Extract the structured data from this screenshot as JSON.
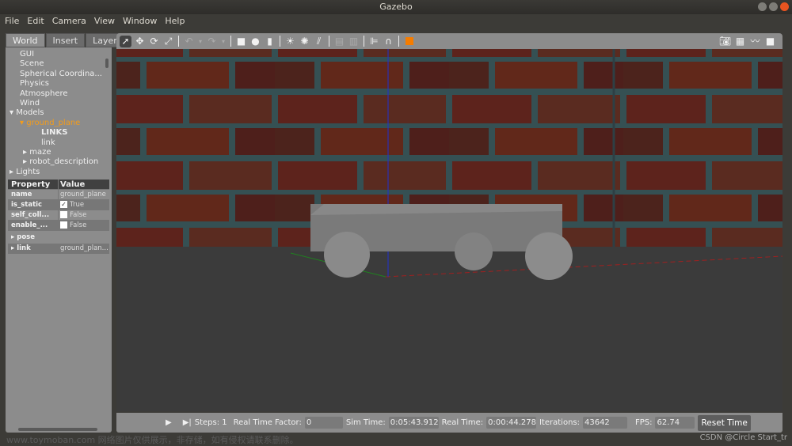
{
  "window": {
    "title": "Gazebo"
  },
  "menu": [
    "File",
    "Edit",
    "Camera",
    "View",
    "Window",
    "Help"
  ],
  "left_panel": {
    "tabs": [
      "World",
      "Insert",
      "Layers"
    ],
    "tree": [
      "GUI",
      "Scene",
      "Spherical Coordina...",
      "Physics",
      "Atmosphere",
      "Wind",
      "Models",
      "ground_plane",
      "LINKS",
      "link",
      "maze",
      "robot_description",
      "Lights"
    ],
    "properties": {
      "headers": [
        "Property",
        "Value"
      ],
      "rows": [
        {
          "key": "name",
          "value": "ground_plane"
        },
        {
          "key": "is_static",
          "value": "True",
          "checked": true
        },
        {
          "key": "self_coll...",
          "value": "False",
          "checked": false
        },
        {
          "key": "enable_...",
          "value": "False",
          "checked": false
        },
        {
          "key": "pose",
          "value": ""
        },
        {
          "key": "link",
          "value": "ground_plan..."
        }
      ]
    }
  },
  "toolbar": {
    "icons": [
      "select-arrow",
      "translate",
      "rotate",
      "scale",
      "undo",
      "redo",
      "box",
      "sphere",
      "cylinder",
      "point-light",
      "spot-light",
      "directional-light",
      "copy",
      "paste",
      "align",
      "snap",
      "view-angle"
    ],
    "right_icons": [
      "screenshot",
      "log",
      "plot",
      "video-record"
    ]
  },
  "bottom_bar": {
    "steps_label": "Steps: 1",
    "rtf_label": "Real Time Factor:",
    "rtf_value": "0",
    "sim_label": "Sim Time:",
    "sim_value": "0:05:43.912",
    "real_label": "Real Time:",
    "real_value": "0:00:44.278",
    "iter_label": "Iterations:",
    "iter_value": "43642",
    "fps_label": "FPS:",
    "fps_value": "62.74",
    "reset_label": "Reset Time"
  },
  "watermark": {
    "left": "www.toymoban.com 网络图片仅供展示，非存储，如有侵权请联系删除。",
    "right": "CSDN @Circle Start_tr"
  },
  "colors": {
    "selected": "#f39c1b",
    "brick": "#6e2a22",
    "mortar": "#3f5e62"
  }
}
